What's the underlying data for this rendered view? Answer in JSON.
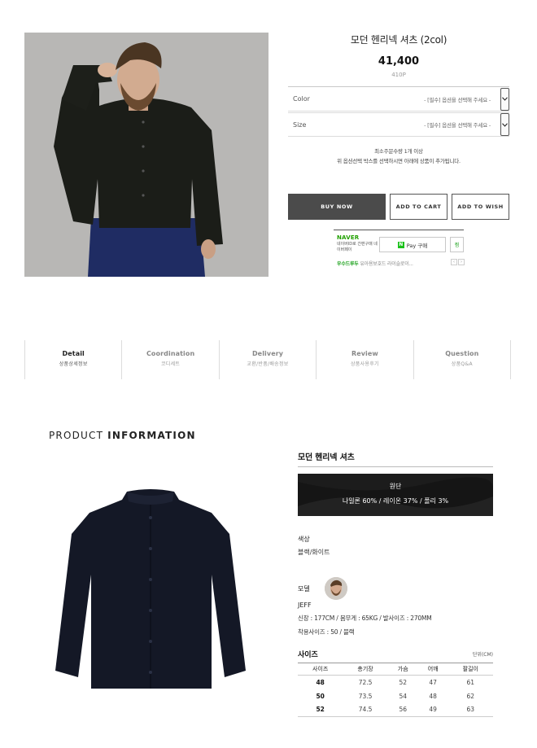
{
  "product": {
    "name": "모던 헨리넥 셔츠 (2col)",
    "price": "41,400",
    "point": "410P"
  },
  "options": [
    {
      "label": "Color",
      "placeholder": "- [필수] 옵션을 선택해 주세요 -"
    },
    {
      "label": "Size",
      "placeholder": "- [필수] 옵션을 선택해 주세요 -"
    }
  ],
  "notes": {
    "min_qty": "최소주문수량 1개 이상",
    "guide": "위 옵션선택 박스를 선택하시면 아래에 상품이 추가됩니다."
  },
  "buttons": {
    "buy": "BUY NOW",
    "cart": "ADD TO CART",
    "wish": "ADD TO WISH"
  },
  "naver": {
    "logo": "NAVER",
    "sub": "네이버ID로 간편구매 네이버페이",
    "pay": "Pay 구매",
    "pay_n": "N",
    "zzim": "찜",
    "event_label": "우수드루두",
    "event_text": "유아용보호드 라이슬로이..."
  },
  "tabs": [
    {
      "title": "Detail",
      "sub": "상품상세정보",
      "active": true
    },
    {
      "title": "Coordination",
      "sub": "코디세트",
      "active": false
    },
    {
      "title": "Delivery",
      "sub": "교환/반품/배송정보",
      "active": false
    },
    {
      "title": "Review",
      "sub": "상품사용후기",
      "active": false
    },
    {
      "title": "Question",
      "sub": "상품Q&A",
      "active": false
    }
  ],
  "info": {
    "title_light": "PRODUCT",
    "title_bold": "INFORMATION",
    "name": "모던 헨리넥 셔츠",
    "fabric_title": "원단",
    "fabric_value": "나일론 60% / 레이온 37% / 폴리 3%",
    "color_label": "색상",
    "color_value": "블랙/화이트",
    "model_label": "모델",
    "model_name": "JEFF",
    "model_stats": "신장 : 177CM / 몸무게 : 65KG / 발사이즈 : 270MM",
    "model_size": "착용사이즈 : 50 / 블랙",
    "size_title": "사이즈",
    "size_unit": "단위(CM)"
  },
  "size_table": {
    "headers": [
      "사이즈",
      "총기장",
      "가슴",
      "어깨",
      "팔길이"
    ],
    "rows": [
      [
        "48",
        "72.5",
        "52",
        "47",
        "61"
      ],
      [
        "50",
        "73.5",
        "54",
        "48",
        "62"
      ],
      [
        "52",
        "74.5",
        "56",
        "49",
        "63"
      ]
    ]
  },
  "colors": {
    "buy_button": "#4b4b4b",
    "naver_green": "#19c119",
    "fabric_bg": "#151515"
  }
}
